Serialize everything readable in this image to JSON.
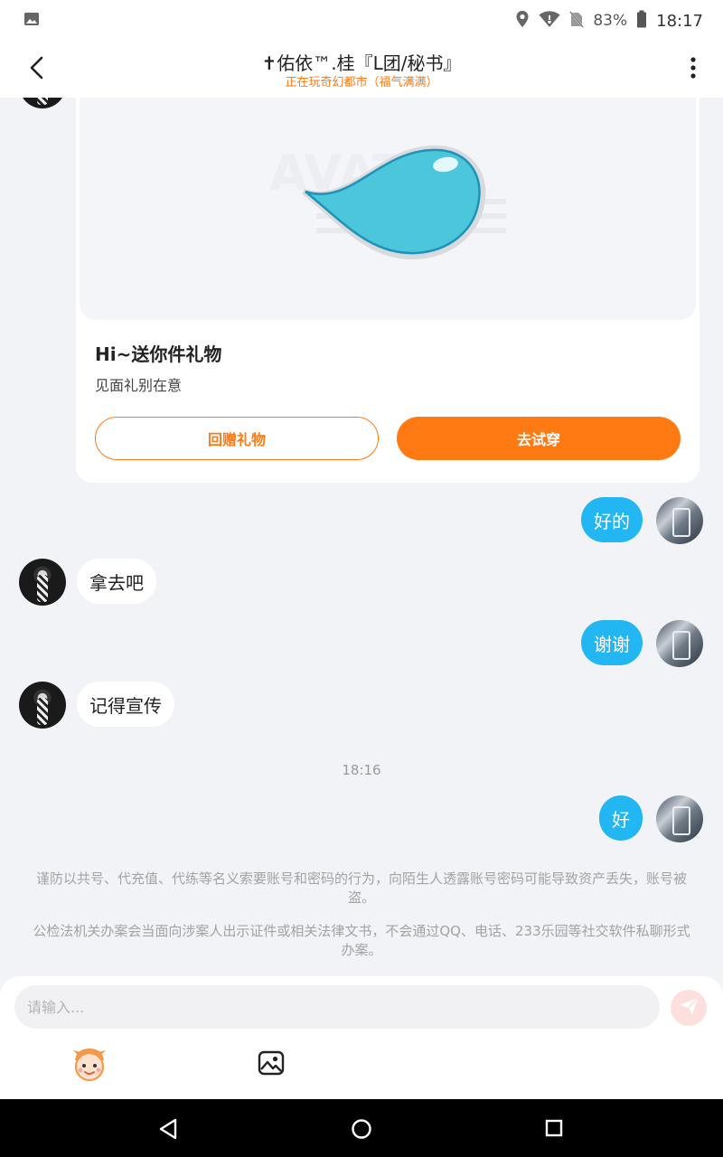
{
  "status_bar": {
    "battery": "83%",
    "time": "18:17"
  },
  "header": {
    "title": "✝佑依™.桂『L团/秘书』",
    "subtitle": "正在玩奇幻都市（福气满满）"
  },
  "gift_card": {
    "title": "Hi~送你件礼物",
    "description": "见面礼别在意",
    "return_gift_label": "回赠礼物",
    "try_on_label": "去试穿"
  },
  "messages": [
    {
      "from": "me",
      "text": "好的"
    },
    {
      "from": "other",
      "text": "拿去吧"
    },
    {
      "from": "me",
      "text": "谢谢"
    },
    {
      "from": "other",
      "text": "记得宣传"
    },
    {
      "from": "me",
      "text": "好"
    }
  ],
  "timestamp": "18:16",
  "notices": [
    "谨防以共号、代充值、代练等名义索要账号和密码的行为，向陌生人透露账号密码可能导致资产丢失，账号被盗。",
    "公检法机关办案会当面向涉案人出示证件或相关法律文书，不会通过QQ、电话、233乐园等社交软件私聊形式办案。"
  ],
  "composer": {
    "placeholder": "请输入..."
  },
  "colors": {
    "accent_orange": "#ff7a12",
    "bubble_blue": "#22b6f2",
    "background": "#f2f3f7"
  },
  "icons": {
    "status_left": "gallery-icon",
    "location": "location-pin-icon",
    "wifi": "wifi-icon",
    "no_sim": "no-sim-icon",
    "battery": "battery-icon",
    "back": "back-arrow-icon",
    "more": "more-vertical-icon",
    "send": "send-icon",
    "emoji": "emoji-avatar-icon",
    "image": "image-icon"
  }
}
